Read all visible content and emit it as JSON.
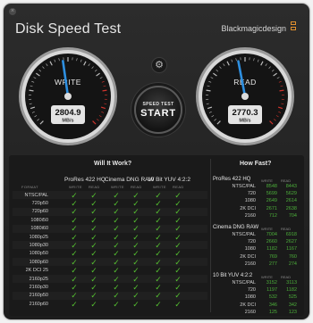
{
  "window": {
    "close_glyph": "×",
    "title": "Disk Speed Test",
    "brand": "Blackmagicdesign"
  },
  "colors": {
    "ok": "#55c030",
    "fast": "#4caf3a",
    "slow": "#3c7a30",
    "needle": "#2e8fe0",
    "redline": "#d0342c"
  },
  "gauges": {
    "write": {
      "label": "WRITE",
      "value": "2804.9",
      "unit": "MB/s",
      "level": 0.47
    },
    "read": {
      "label": "READ",
      "value": "2770.3",
      "unit": "MB/s",
      "level": 0.46
    }
  },
  "controls": {
    "settings_icon": "gear-icon",
    "gear_glyph": "⚙",
    "start_small": "SPEED TEST",
    "start_big": "START"
  },
  "will_it_work": {
    "title": "Will It Work?",
    "format_header": "FORMAT",
    "columns": [
      {
        "name": "ProRes 422 HQ",
        "sub": [
          "WRITE",
          "READ"
        ]
      },
      {
        "name": "Cinema DNG RAW",
        "sub": [
          "WRITE",
          "READ"
        ]
      },
      {
        "name": "10 Bit YUV 4:2:2",
        "sub": [
          "WRITE",
          "READ"
        ]
      }
    ],
    "check_glyph": "✓",
    "rows": [
      "NTSC/PAL",
      "720p50",
      "720p60",
      "1080i50",
      "1080i60",
      "1080p25",
      "1080p30",
      "1080p50",
      "1080p60",
      "2K DCI 25",
      "2160p25",
      "2160p30",
      "2160p50",
      "2160p60"
    ]
  },
  "how_fast": {
    "title": "How Fast?",
    "sub": [
      "WRITE",
      "READ"
    ],
    "groups": [
      {
        "name": "ProRes 422 HQ",
        "rows": [
          {
            "label": "NTSC/PAL",
            "write": "8548",
            "read": "8443"
          },
          {
            "label": "720",
            "write": "5699",
            "read": "5629"
          },
          {
            "label": "1080",
            "write": "2649",
            "read": "2614"
          },
          {
            "label": "2K DCI",
            "write": "2671",
            "read": "2638"
          },
          {
            "label": "2160",
            "write": "712",
            "read": "704"
          }
        ]
      },
      {
        "name": "Cinema DNG RAW",
        "rows": [
          {
            "label": "NTSC/PAL",
            "write": "7004",
            "read": "6918"
          },
          {
            "label": "720",
            "write": "2660",
            "read": "2627"
          },
          {
            "label": "1080",
            "write": "1182",
            "read": "1167"
          },
          {
            "label": "2K DCI",
            "write": "769",
            "read": "760"
          },
          {
            "label": "2160",
            "write": "277",
            "read": "274"
          }
        ]
      },
      {
        "name": "10 Bit YUV 4:2:2",
        "rows": [
          {
            "label": "NTSC/PAL",
            "write": "3152",
            "read": "3113"
          },
          {
            "label": "720",
            "write": "1197",
            "read": "1182"
          },
          {
            "label": "1080",
            "write": "532",
            "read": "525"
          },
          {
            "label": "2K DCI",
            "write": "346",
            "read": "342"
          },
          {
            "label": "2160",
            "write": "125",
            "read": "123"
          }
        ]
      }
    ]
  }
}
